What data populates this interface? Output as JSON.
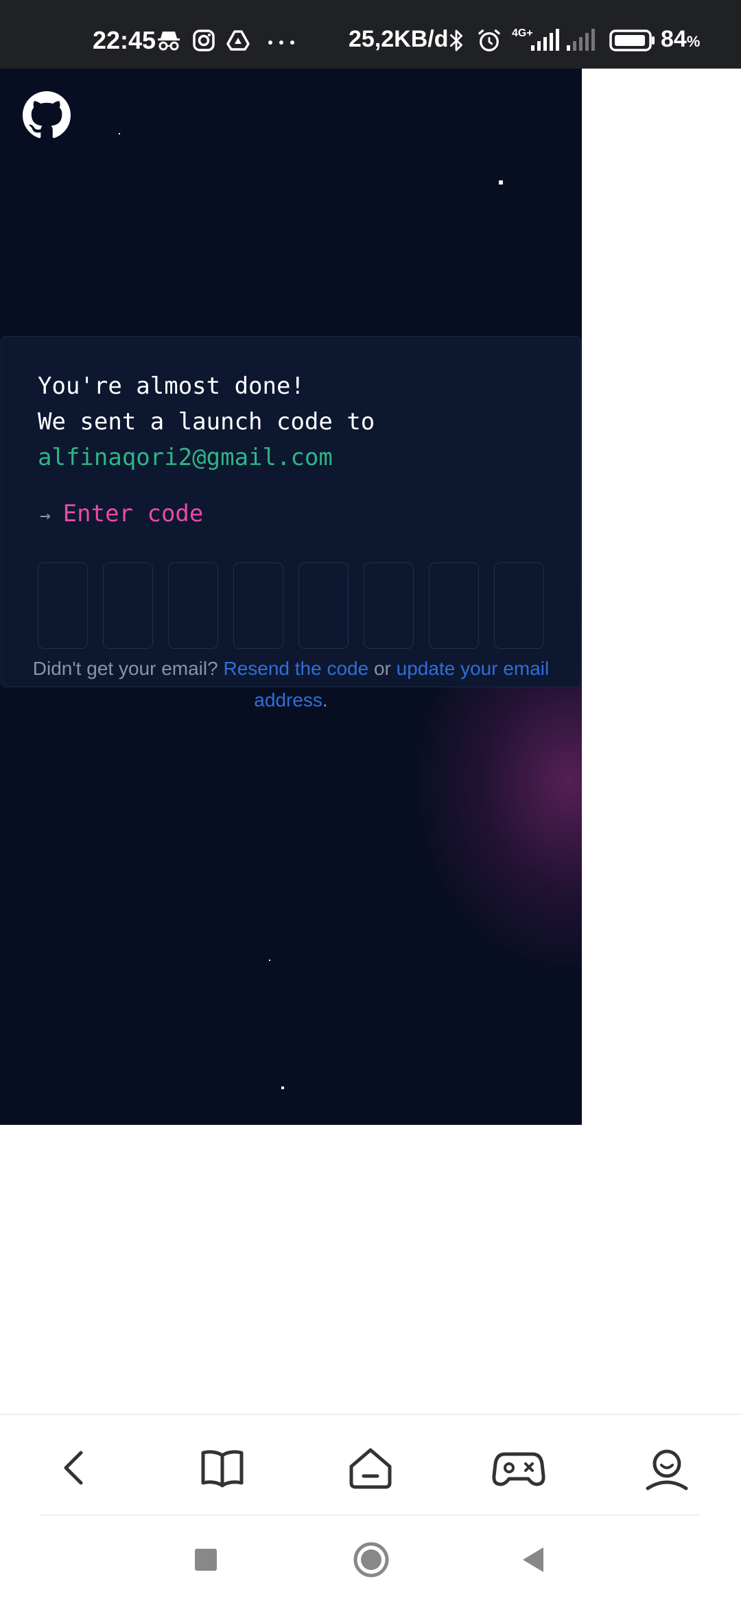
{
  "status_bar": {
    "time": "22:45",
    "network_speed": "25,2KB/d",
    "battery_percent": "84",
    "battery_unit": "%",
    "network_type": "4G+",
    "icons": [
      "incognito-icon",
      "instagram-icon",
      "drive-icon",
      "more-dots-icon",
      "bluetooth-icon",
      "alarm-icon",
      "signal-icon",
      "signal-weak-icon",
      "battery-icon"
    ]
  },
  "page": {
    "logo": "github-icon",
    "heading_line1": "You're almost done!",
    "heading_line2": "We sent a launch code to",
    "email": "alfinaqori2@gmail.com",
    "prompt_arrow": "→",
    "prompt_label": "Enter code",
    "code_boxes": [
      "",
      "",
      "",
      "",
      "",
      "",
      "",
      ""
    ],
    "help_prefix": "Didn't get your email?",
    "resend_link": "Resend the code",
    "help_or": "or",
    "update_link": "update your email address",
    "help_suffix": "."
  },
  "browser_nav": {
    "items": [
      "back-icon",
      "bookmarks-icon",
      "home-icon",
      "games-icon",
      "profile-icon"
    ]
  },
  "system_nav": {
    "items": [
      "recents-icon",
      "home-circle-icon",
      "back-triangle-icon"
    ]
  }
}
